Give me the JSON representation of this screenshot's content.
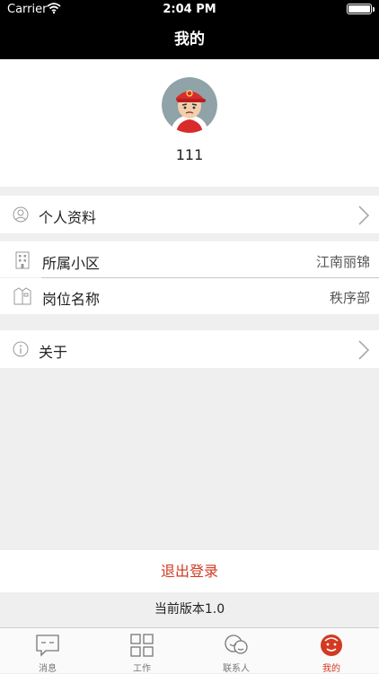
{
  "status_bar": {
    "carrier": "Carrier",
    "time": "2:04 PM"
  },
  "nav": {
    "title": "我的"
  },
  "profile": {
    "username": "111"
  },
  "menu": {
    "personal_info": {
      "label": "个人资料"
    },
    "community": {
      "label": "所属小区",
      "value": "江南丽锦"
    },
    "position": {
      "label": "岗位名称",
      "value": "秩序部"
    },
    "about": {
      "label": "关于"
    }
  },
  "logout_label": "退出登录",
  "version_label": "当前版本1.0",
  "tabs": [
    {
      "label": "消息",
      "icon": "message-icon",
      "active": false
    },
    {
      "label": "工作",
      "icon": "grid-icon",
      "active": false
    },
    {
      "label": "联系人",
      "icon": "contacts-icon",
      "active": false
    },
    {
      "label": "我的",
      "icon": "profile-icon",
      "active": true
    }
  ],
  "colors": {
    "accent": "#d23a22",
    "nav_background": "#000000",
    "page_background": "#efefef"
  }
}
